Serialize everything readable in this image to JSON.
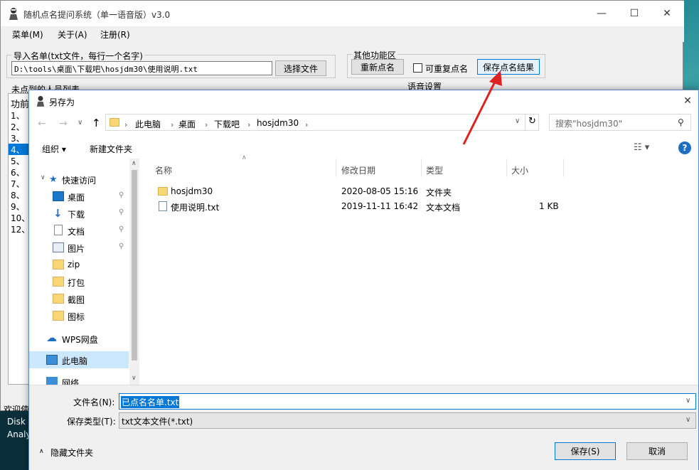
{
  "main": {
    "title": "随机点名提问系统（单一语音版）v3.0",
    "min": "—",
    "max": "☐",
    "close": "✕",
    "menu": [
      "菜单(M)",
      "关于(A)",
      "注册(R)"
    ],
    "import_label": "导入名单(txt文件，每行一个名字)",
    "import_path": "D:\\tools\\桌面\\下载吧\\hosjdm30\\使用说明.txt",
    "choose_file": "选择文件",
    "other_label": "其他功能区",
    "reset_btn": "重新点名",
    "repeat_label": "可重复点名",
    "save_result_btn": "保存点名结果",
    "voice_label": "语音设置",
    "uncalled_label": "未点到的人员列表",
    "list_items": [
      "功前",
      "1、",
      "2、",
      "3、",
      "4、",
      "5、",
      "6、",
      "7、",
      "8、",
      "9、",
      "10、",
      "12、"
    ],
    "status": [
      "欢迎使",
      "Disk",
      "Analy"
    ]
  },
  "dialog": {
    "title": "另存为",
    "close": "✕",
    "breadcrumb": [
      "此电脑",
      "桌面",
      "下载吧",
      "hosjdm30"
    ],
    "search_placeholder": "搜索\"hosjdm30\"",
    "organize": "组织 ▾",
    "new_folder": "新建文件夹",
    "help": "?",
    "sidebar": {
      "quick_access": "快速访问",
      "items": [
        "桌面",
        "下载",
        "文档",
        "图片",
        "zip",
        "打包",
        "截图",
        "图标"
      ],
      "wps": "WPS网盘",
      "this_pc": "此电脑",
      "network": "网络"
    },
    "columns": [
      "名称",
      "修改日期",
      "类型",
      "大小"
    ],
    "files": [
      {
        "name": "hosjdm30",
        "date": "2020-08-05 15:16",
        "type": "文件夹",
        "size": ""
      },
      {
        "name": "使用说明.txt",
        "date": "2019-11-11 16:42",
        "type": "文本文档",
        "size": "1 KB"
      }
    ],
    "filename_label": "文件名(N):",
    "filename_value": "已点名名单.txt",
    "filetype_label": "保存类型(T):",
    "filetype_value": "txt文本文件(*.txt)",
    "hide_folders": "隐藏文件夹",
    "save_btn": "保存(S)",
    "cancel_btn": "取消"
  },
  "colors": {
    "arrow": "#d22",
    "accent": "#0078d7",
    "selection": "#cce8ff"
  }
}
